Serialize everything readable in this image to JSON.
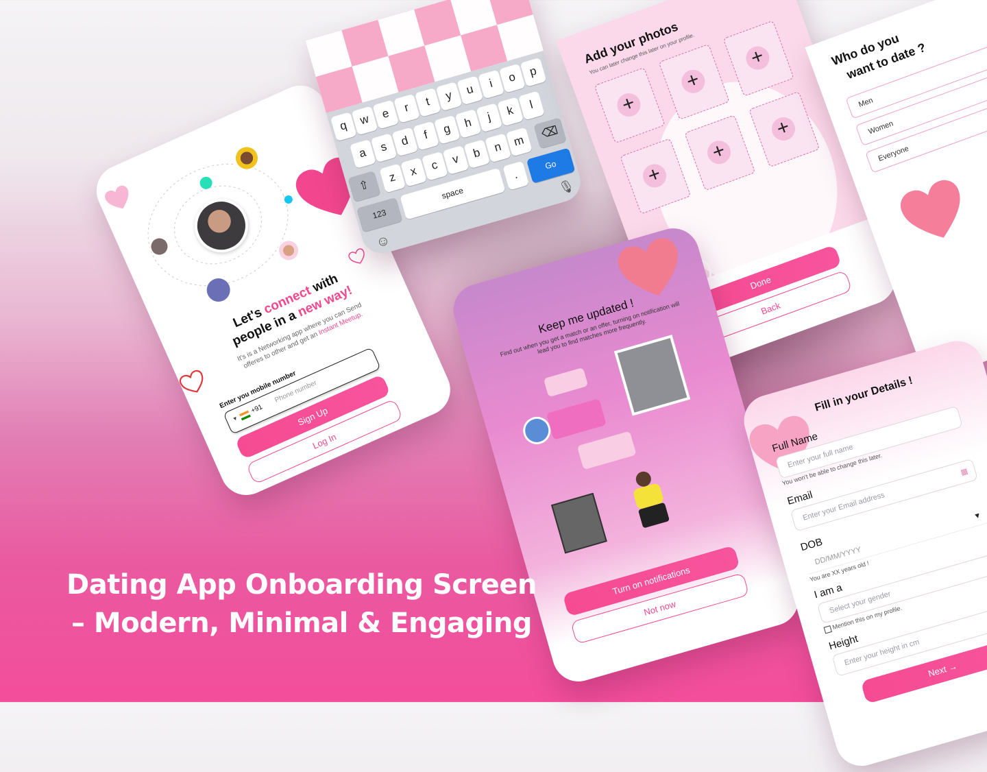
{
  "headline": {
    "line1": "Dating App Onboarding Screen",
    "line2": "– Modern, Minimal & Engaging"
  },
  "colors": {
    "accent": "#f2478f",
    "soft": "#f7c3dd",
    "purple": "#6b6fb6",
    "teal": "#27e0b7"
  },
  "signup": {
    "title_pre": "Let's ",
    "title_accent1": "connect",
    "title_mid": " with",
    "title_line2_pre": "people in a ",
    "title_accent2": "new way!",
    "desc_line1": "It's  is a Networking app where you can Send",
    "desc_line2_pre": "offeres to other and get an ",
    "desc_accent": "Instant Meetup.",
    "phone_label": "Enter you mobile number",
    "country_code": "+91",
    "phone_placeholder": "Phone number",
    "signup_button": "Sign Up",
    "login_button": "Log In"
  },
  "keyboard": {
    "row1": [
      "q",
      "w",
      "e",
      "r",
      "t",
      "y",
      "u",
      "i",
      "o",
      "p"
    ],
    "row2": [
      "a",
      "s",
      "d",
      "f",
      "g",
      "h",
      "j",
      "k",
      "l"
    ],
    "row3": [
      "z",
      "x",
      "c",
      "v",
      "b",
      "n",
      "m"
    ],
    "numbers_key": "123",
    "space_key": "space",
    "go_key": "Go",
    "period_key": "."
  },
  "photos": {
    "title": "Add your photos",
    "subtitle": "You can later change this later on your profile.",
    "plus": "+",
    "done_button": "Done",
    "back_button": "Back"
  },
  "notify": {
    "title": "Keep me updated !",
    "desc": "Find out when you get a match or an offer, turning on notification will lead you to find matches more frequently.",
    "on_button": "Turn on notifications",
    "off_button": "Not now"
  },
  "preference": {
    "title_line1": "Who do you",
    "title_line2": "want to date ?",
    "options": [
      "Men",
      "Women",
      "Everyone"
    ]
  },
  "details": {
    "title": "Fill in your Details !",
    "fullname_label": "Full Name",
    "fullname_placeholder": "Enter your full name",
    "fullname_hint": "You won't be able to change this later.",
    "email_label": "Email",
    "email_placeholder": "Enter your Email address",
    "dob_label": "DOB",
    "dob_placeholder": "DD/MM/YYYY",
    "dob_hint": "You are XX years old !",
    "gender_label": "I am a",
    "gender_placeholder": "Select your gender",
    "gender_checkbox": "Mention this on my profile.",
    "height_label": "Height",
    "height_placeholder": "Enter your height in cm",
    "next_button": "Next →"
  }
}
